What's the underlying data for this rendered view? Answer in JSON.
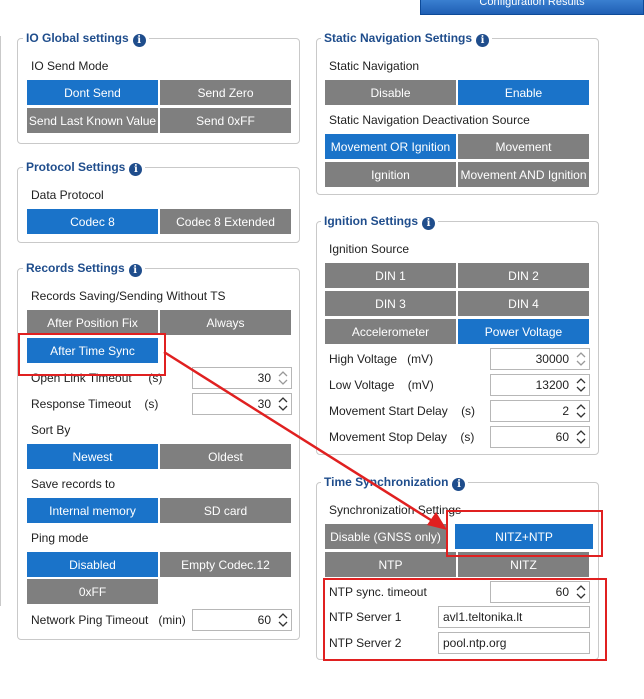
{
  "topbar": {
    "label": "Configuration Results"
  },
  "io_global": {
    "title": "IO Global settings",
    "send_mode_label": "IO Send Mode",
    "buttons": [
      "Dont Send",
      "Send Zero",
      "Send Last Known Value",
      "Send 0xFF"
    ]
  },
  "protocol": {
    "title": "Protocol Settings",
    "data_protocol_label": "Data Protocol",
    "buttons": [
      "Codec 8",
      "Codec 8 Extended"
    ]
  },
  "records": {
    "title": "Records Settings",
    "saving_label": "Records Saving/Sending Without TS",
    "saving_buttons": [
      "After Position Fix",
      "Always",
      "After Time Sync"
    ],
    "open_link_label": "Open Link Timeout",
    "open_link_unit": "(s)",
    "open_link_value": "30",
    "response_label": "Response Timeout",
    "response_unit": "(s)",
    "response_value": "30",
    "sort_label": "Sort By",
    "sort_buttons": [
      "Newest",
      "Oldest"
    ],
    "save_to_label": "Save records to",
    "save_to_buttons": [
      "Internal memory",
      "SD card"
    ],
    "ping_label": "Ping mode",
    "ping_buttons": [
      "Disabled",
      "Empty Codec.12",
      "0xFF"
    ],
    "net_ping_label": "Network Ping Timeout",
    "net_ping_unit": "(min)",
    "net_ping_value": "60"
  },
  "static_nav": {
    "title": "Static Navigation Settings",
    "label": "Static Navigation",
    "buttons": [
      "Disable",
      "Enable"
    ],
    "source_label": "Static Navigation Deactivation Source",
    "source_buttons": [
      "Movement OR Ignition",
      "Movement",
      "Ignition",
      "Movement AND Ignition"
    ]
  },
  "ignition": {
    "title": "Ignition Settings",
    "source_label": "Ignition Source",
    "buttons": [
      "DIN 1",
      "DIN 2",
      "DIN 3",
      "DIN 4",
      "Accelerometer",
      "Power Voltage"
    ],
    "high_label": "High Voltage",
    "high_unit": "(mV)",
    "high_value": "30000",
    "low_label": "Low Voltage",
    "low_unit": "(mV)",
    "low_value": "13200",
    "start_label": "Movement Start Delay",
    "start_unit": "(s)",
    "start_value": "2",
    "stop_label": "Movement Stop Delay",
    "stop_unit": "(s)",
    "stop_value": "60"
  },
  "time_sync": {
    "title": "Time Synchronization",
    "sync_label": "Synchronization Settings",
    "buttons": [
      "Disable (GNSS only)",
      "NITZ+NTP",
      "NTP",
      "NITZ"
    ],
    "ntp_timeout_label": "NTP sync. timeout",
    "ntp_timeout_value": "60",
    "server1_label": "NTP Server 1",
    "server1_value": "avl1.teltonika.lt",
    "server2_label": "NTP Server 2",
    "server2_value": "pool.ntp.org"
  },
  "colors": {
    "active": "#1a73c9",
    "inactive": "#7f7f7f",
    "title": "#1f4d8c",
    "highlight": "#e02020"
  }
}
